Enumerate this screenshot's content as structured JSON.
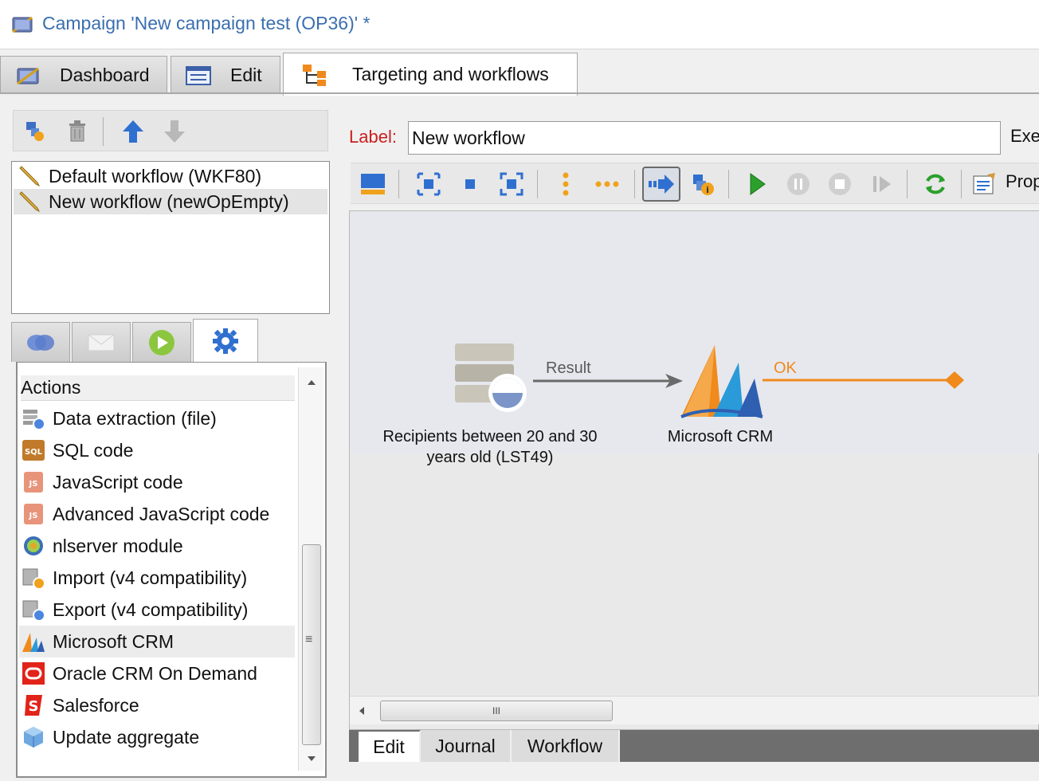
{
  "window": {
    "title": "Campaign 'New campaign test (OP36)' *"
  },
  "tabs": [
    {
      "label": "Dashboard",
      "icon": "campaign-icon"
    },
    {
      "label": "Edit",
      "icon": "form-icon"
    },
    {
      "label": "Targeting and workflows",
      "icon": "workflow-icon",
      "active": true
    }
  ],
  "workflows": {
    "items": [
      {
        "label": "Default workflow (WKF80)",
        "icon": "pencil-icon"
      },
      {
        "label": "New workflow (newOpEmpty)",
        "icon": "pencil-icon",
        "selected": true
      }
    ]
  },
  "palette": {
    "tabs": [
      "targeting-icon",
      "delivery-icon",
      "flow-control-icon",
      "actions-gear-icon"
    ],
    "header": "Actions",
    "items": [
      {
        "label": "Data extraction (file)",
        "icon": "data-extraction-icon"
      },
      {
        "label": "SQL code",
        "icon": "sql-icon",
        "badge": "SQL"
      },
      {
        "label": "JavaScript code",
        "icon": "js-icon",
        "badge": "JS"
      },
      {
        "label": "Advanced JavaScript code",
        "icon": "js-icon",
        "badge": "JS"
      },
      {
        "label": "nlserver module",
        "icon": "nlserver-icon"
      },
      {
        "label": "Import (v4 compatibility)",
        "icon": "import-icon"
      },
      {
        "label": "Export (v4 compatibility)",
        "icon": "export-icon"
      },
      {
        "label": "Microsoft CRM",
        "icon": "microsoft-crm-icon",
        "selected": true
      },
      {
        "label": "Oracle CRM On Demand",
        "icon": "oracle-icon"
      },
      {
        "label": "Salesforce",
        "icon": "salesforce-icon"
      },
      {
        "label": "Update aggregate",
        "icon": "update-aggregate-icon"
      }
    ],
    "scroll_glyph": "≡"
  },
  "editor": {
    "label_caption": "Label:",
    "label_value": "New workflow",
    "exec_label": "Exe",
    "props_label": "Prop"
  },
  "canvas": {
    "nodes": [
      {
        "label_line1": "Recipients between 20 and 30",
        "label_line2": "years old (LST49)",
        "icon": "list-database-icon"
      },
      {
        "label_line1": "Microsoft CRM",
        "icon": "microsoft-crm-icon"
      }
    ],
    "transitions": [
      {
        "label": "Result",
        "color": "#6a6a6a"
      },
      {
        "label": "OK",
        "color": "#f08a1c"
      }
    ],
    "scroll_grip": "III"
  },
  "bottom_tabs": [
    "Edit",
    "Journal",
    "Workflow"
  ],
  "colors": {
    "accent_blue": "#3a6fb0",
    "label_red": "#c8201e",
    "orange": "#f08a1c"
  }
}
